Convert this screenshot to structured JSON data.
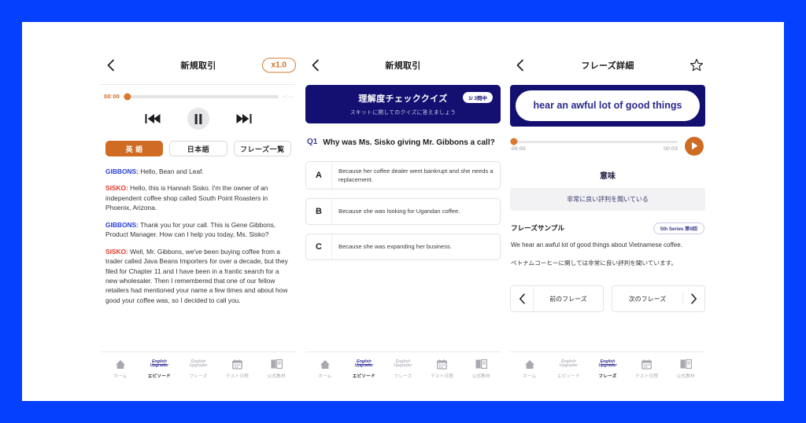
{
  "theme": {
    "border_blue": "#0540ff",
    "navy": "#141072",
    "orange": "#cf6b22",
    "page_bg": "#ffffff"
  },
  "panel_player": {
    "header": {
      "back_icon": "chevron-left-icon",
      "title": "新規取引",
      "speed_badge": "x1.0"
    },
    "audio": {
      "current_time": "00:00",
      "duration": "--:--",
      "progress_percent": 2,
      "prev_icon": "skip-back-icon",
      "pause_icon": "pause-icon",
      "next_icon": "skip-forward-icon"
    },
    "segments": [
      {
        "label": "英 語",
        "active": true
      },
      {
        "label": "日本語",
        "active": false
      },
      {
        "label": "フレーズ一覧",
        "active": false
      }
    ],
    "transcript": [
      {
        "speaker": "GIBBONS:",
        "speaker_color": "blue",
        "text": " Hello, Bean and Leaf."
      },
      {
        "speaker": "SISKO:",
        "speaker_color": "red",
        "text": " Hello, this is Hannah Sisko. I'm the owner of an independent coffee shop called South Point Roasters in Phoenix, Arizona."
      },
      {
        "speaker": "GIBBONS:",
        "speaker_color": "blue",
        "text": " Thank you for your call. This is Gene Gibbons, Product Manager. How can I help you today, Ms. Sisko?"
      },
      {
        "speaker": "SISKO:",
        "speaker_color": "red",
        "text": " Well, Mr. Gibbons, we've been buying coffee from a trader called Java Beans Importers for over a decade, but they filed for Chapter 11 and I have been in a frantic search for a new wholesaler. Then I remembered that one of our fellow retailers had mentioned your name a few times and about how good your coffee was, so I decided to call you."
      }
    ],
    "tabs": [
      {
        "label": "ホーム",
        "icon": "home-icon",
        "active": false
      },
      {
        "label": "エピソード",
        "icon": "english-upgrader-icon",
        "active": true
      },
      {
        "label": "フレーズ",
        "icon": "english-upgrader-icon",
        "active": false
      },
      {
        "label": "テスト日程",
        "icon": "calendar-icon",
        "active": false
      },
      {
        "label": "公式教材",
        "icon": "book-icon",
        "active": false
      }
    ]
  },
  "panel_quiz": {
    "header": {
      "back_icon": "chevron-left-icon",
      "title": "新規取引"
    },
    "banner": {
      "title": "理解度チェッククイズ",
      "subtitle": "スキットに関してのクイズに答えましょう",
      "count": "1/ 3問中"
    },
    "question": {
      "number": "Q1",
      "text": "Why was Ms. Sisko giving Mr. Gibbons a call?"
    },
    "choices": [
      {
        "letter": "A",
        "text": "Because her coffee dealer went bankrupt and she needs a replacement."
      },
      {
        "letter": "B",
        "text": "Because she was looking for Ugandan coffee."
      },
      {
        "letter": "C",
        "text": "Because she was expanding her business."
      }
    ],
    "tabs": [
      {
        "label": "ホーム",
        "icon": "home-icon",
        "active": false
      },
      {
        "label": "エピソード",
        "icon": "english-upgrader-icon",
        "active": true
      },
      {
        "label": "フレーズ",
        "icon": "english-upgrader-icon",
        "active": false
      },
      {
        "label": "テスト日程",
        "icon": "calendar-icon",
        "active": false
      },
      {
        "label": "公式教材",
        "icon": "book-icon",
        "active": false
      }
    ]
  },
  "panel_phrase": {
    "header": {
      "back_icon": "chevron-left-icon",
      "title": "フレーズ詳細",
      "star_icon": "star-outline-icon"
    },
    "phrase": "hear an awful lot of good things",
    "audio": {
      "current_time": "00:00",
      "duration": "00:03",
      "progress_percent": 1,
      "play_icon": "play-icon"
    },
    "meaning_heading": "意味",
    "meaning_text": "非常に良い評判を聞いている",
    "sample_heading": "フレーズサンプル",
    "series_badge": "5th Series 第9回",
    "sample_en": "We hear an awful lot of good things about Vietnamese coffee.",
    "sample_jp": "ベトナムコーヒーに関しては非常に良い評判を聞いています。",
    "nav": {
      "prev_label": "前のフレーズ",
      "prev_icon": "chevron-left-icon",
      "next_label": "次のフレーズ",
      "next_icon": "chevron-right-icon"
    },
    "tabs": [
      {
        "label": "ホーム",
        "icon": "home-icon",
        "active": false
      },
      {
        "label": "エピソード",
        "icon": "english-upgrader-icon",
        "active": false
      },
      {
        "label": "フレーズ",
        "icon": "english-upgrader-icon",
        "active": true
      },
      {
        "label": "テスト日程",
        "icon": "calendar-icon",
        "active": false
      },
      {
        "label": "公式教材",
        "icon": "book-icon",
        "active": false
      }
    ]
  }
}
